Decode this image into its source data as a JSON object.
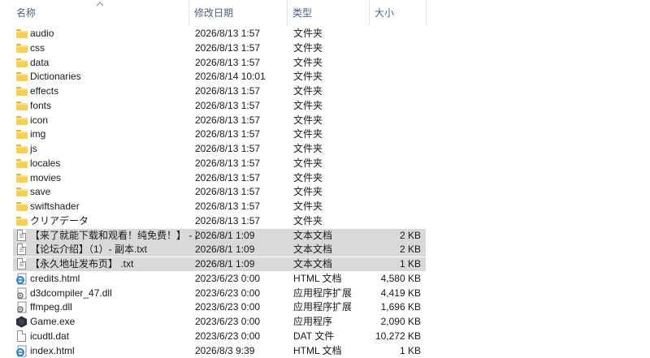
{
  "header": {
    "name": "名称",
    "date": "修改日期",
    "type": "类型",
    "size": "大小"
  },
  "files": [
    {
      "name": "audio",
      "date": "2026/8/13 1:57",
      "type": "文件夹",
      "size": "",
      "icon": "folder-icon"
    },
    {
      "name": "css",
      "date": "2026/8/13 1:57",
      "type": "文件夹",
      "size": "",
      "icon": "folder-icon"
    },
    {
      "name": "data",
      "date": "2026/8/13 1:57",
      "type": "文件夹",
      "size": "",
      "icon": "folder-icon"
    },
    {
      "name": "Dictionaries",
      "date": "2026/8/14 10:01",
      "type": "文件夹",
      "size": "",
      "icon": "folder-icon"
    },
    {
      "name": "effects",
      "date": "2026/8/13 1:57",
      "type": "文件夹",
      "size": "",
      "icon": "folder-icon"
    },
    {
      "name": "fonts",
      "date": "2026/8/13 1:57",
      "type": "文件夹",
      "size": "",
      "icon": "folder-icon"
    },
    {
      "name": "icon",
      "date": "2026/8/13 1:57",
      "type": "文件夹",
      "size": "",
      "icon": "folder-icon"
    },
    {
      "name": "img",
      "date": "2026/8/13 1:57",
      "type": "文件夹",
      "size": "",
      "icon": "folder-icon"
    },
    {
      "name": "js",
      "date": "2026/8/13 1:57",
      "type": "文件夹",
      "size": "",
      "icon": "folder-icon"
    },
    {
      "name": "locales",
      "date": "2026/8/13 1:57",
      "type": "文件夹",
      "size": "",
      "icon": "folder-icon"
    },
    {
      "name": "movies",
      "date": "2026/8/13 1:57",
      "type": "文件夹",
      "size": "",
      "icon": "folder-icon"
    },
    {
      "name": "save",
      "date": "2026/8/13 1:57",
      "type": "文件夹",
      "size": "",
      "icon": "folder-icon"
    },
    {
      "name": "swiftshader",
      "date": "2026/8/13 1:57",
      "type": "文件夹",
      "size": "",
      "icon": "folder-icon"
    },
    {
      "name": "クリアデータ",
      "date": "2026/8/13 1:57",
      "type": "文件夹",
      "size": "",
      "icon": "folder-icon"
    },
    {
      "name": "【来了就能下载和观看！纯免费！】 - 副...",
      "date": "2026/8/1 1:09",
      "type": "文本文档",
      "size": "2 KB",
      "icon": "text-document-icon",
      "selected": true
    },
    {
      "name": "【论坛介绍】（1）- 副本.txt",
      "date": "2026/8/1 1:09",
      "type": "文本文档",
      "size": "2 KB",
      "icon": "text-document-icon",
      "selected": true
    },
    {
      "name": "【永久地址发布页】 .txt",
      "date": "2026/8/1 1:09",
      "type": "文本文档",
      "size": "1 KB",
      "icon": "text-document-icon",
      "selected": true
    },
    {
      "name": "credits.html",
      "date": "2023/6/23 0:00",
      "type": "HTML 文档",
      "size": "4,580 KB",
      "icon": "html-document-icon"
    },
    {
      "name": "d3dcompiler_47.dll",
      "date": "2023/6/23 0:00",
      "type": "应用程序扩展",
      "size": "4,419 KB",
      "icon": "dll-gear-icon"
    },
    {
      "name": "ffmpeg.dll",
      "date": "2023/6/23 0:00",
      "type": "应用程序扩展",
      "size": "1,696 KB",
      "icon": "dll-gear-icon"
    },
    {
      "name": "Game.exe",
      "date": "2023/6/23 0:00",
      "type": "应用程序",
      "size": "2,090 KB",
      "icon": "application-icon"
    },
    {
      "name": "icudtl.dat",
      "date": "2023/6/23 0:00",
      "type": "DAT 文件",
      "size": "10,272 KB",
      "icon": "blank-document-icon"
    },
    {
      "name": "index.html",
      "date": "2026/8/3 9:39",
      "type": "HTML 文档",
      "size": "1 KB",
      "icon": "html-document-icon"
    }
  ]
}
